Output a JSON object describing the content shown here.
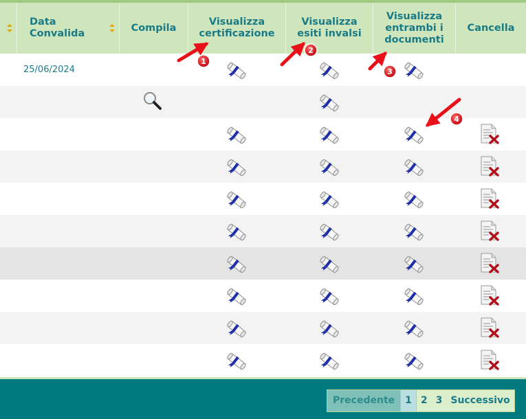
{
  "table": {
    "headers": {
      "data_convalida": "Data Convalida",
      "compila": "Compila",
      "visualizza_certificazione": "Visualizza certificazione",
      "visualizza_esiti_invalsi": "Visualizza esiti invalsi",
      "visualizza_entrambi": "Visualizza entrambi i documenti",
      "cancella": "Cancella"
    },
    "rows": [
      {
        "date": "25/06/2024"
      },
      {
        "date": ""
      },
      {
        "date": ""
      },
      {
        "date": ""
      },
      {
        "date": ""
      },
      {
        "date": ""
      },
      {
        "date": ""
      },
      {
        "date": ""
      },
      {
        "date": ""
      },
      {
        "date": ""
      }
    ]
  },
  "annotations": [
    "1",
    "2",
    "3",
    "4"
  ],
  "pagination": {
    "prev": "Precedente",
    "pages": [
      "1",
      "2",
      "3"
    ],
    "next": "Successivo"
  },
  "colors": {
    "header_bg": "#cfe6bd",
    "header_text": "#1a7b86",
    "footer_bg": "#00797f",
    "annotation": "#e8111a",
    "sort_icon": "#e0a800"
  }
}
